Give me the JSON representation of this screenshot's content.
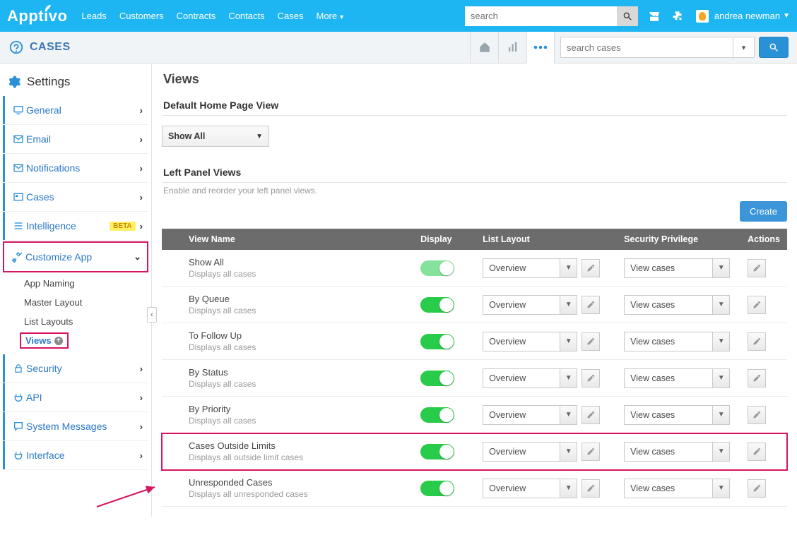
{
  "topbar": {
    "logo": "Apptivo",
    "nav": [
      "Leads",
      "Customers",
      "Contracts",
      "Contacts",
      "Cases"
    ],
    "more": "More",
    "search_placeholder": "search",
    "user": "andrea newman"
  },
  "pagebar": {
    "title": "CASES",
    "search_placeholder": "search cases"
  },
  "sidebar": {
    "settings_title": "Settings",
    "items": [
      {
        "label": "General"
      },
      {
        "label": "Email"
      },
      {
        "label": "Notifications"
      },
      {
        "label": "Cases"
      },
      {
        "label": "Intelligence",
        "beta": "BETA"
      }
    ],
    "customize_label": "Customize App",
    "sub": {
      "app_naming": "App Naming",
      "master_layout": "Master Layout",
      "list_layouts": "List Layouts",
      "views": "Views"
    },
    "items2": [
      {
        "label": "Security"
      },
      {
        "label": "API"
      },
      {
        "label": "System Messages"
      },
      {
        "label": "Interface"
      }
    ]
  },
  "main": {
    "page_title": "Views",
    "default_section": "Default Home Page View",
    "default_value": "Show All",
    "left_panel_title": "Left Panel Views",
    "left_panel_sub": "Enable and reorder your left panel views.",
    "create_btn": "Create",
    "columns": {
      "view_name": "View Name",
      "display": "Display",
      "list_layout": "List Layout",
      "security": "Security Privilege",
      "actions": "Actions"
    },
    "list_layout_value": "Overview",
    "security_value": "View cases",
    "rows": [
      {
        "name": "Show All",
        "desc": "Displays all cases",
        "pale": true
      },
      {
        "name": "By Queue",
        "desc": "Displays all cases"
      },
      {
        "name": "To Follow Up",
        "desc": "Displays all cases"
      },
      {
        "name": "By Status",
        "desc": "Displays all cases"
      },
      {
        "name": "By Priority",
        "desc": "Displays all cases"
      },
      {
        "name": "Cases Outside Limits",
        "desc": "Displays all outside limit cases",
        "highlight": true
      },
      {
        "name": "Unresponded Cases",
        "desc": "Displays all unresponded cases"
      }
    ]
  }
}
